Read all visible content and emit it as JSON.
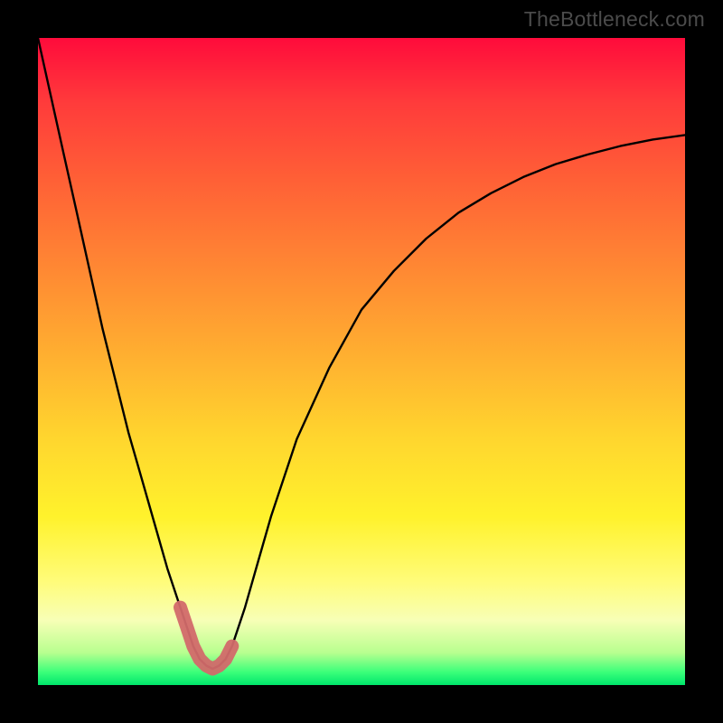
{
  "watermark": "TheBottleneck.com",
  "chart_data": {
    "type": "line",
    "title": "",
    "xlabel": "",
    "ylabel": "",
    "xlim": [
      0,
      100
    ],
    "ylim": [
      0,
      100
    ],
    "grid": false,
    "legend": false,
    "series": [
      {
        "name": "bottleneck-curve",
        "x": [
          0,
          2,
          4,
          6,
          8,
          10,
          12,
          14,
          16,
          18,
          20,
          22,
          23,
          24,
          25,
          26,
          27,
          28,
          29,
          30,
          32,
          34,
          36,
          40,
          45,
          50,
          55,
          60,
          65,
          70,
          75,
          80,
          85,
          90,
          95,
          100
        ],
        "y": [
          100,
          91,
          82,
          73,
          64,
          55,
          47,
          39,
          32,
          25,
          18,
          12,
          9,
          6,
          4,
          3,
          2.5,
          3,
          4,
          6,
          12,
          19,
          26,
          38,
          49,
          58,
          64,
          69,
          73,
          76,
          78.5,
          80.5,
          82,
          83.3,
          84.3,
          85
        ]
      }
    ],
    "highlight": {
      "name": "minimum-band",
      "x": [
        22,
        23,
        24,
        25,
        26,
        27,
        28,
        29,
        30
      ],
      "y": [
        12,
        9,
        6,
        4,
        3,
        2.5,
        3,
        4,
        6
      ]
    },
    "background_gradient": {
      "top": "#ff0b3b",
      "mid": "#ffd62e",
      "bottom": "#00e66b"
    }
  }
}
